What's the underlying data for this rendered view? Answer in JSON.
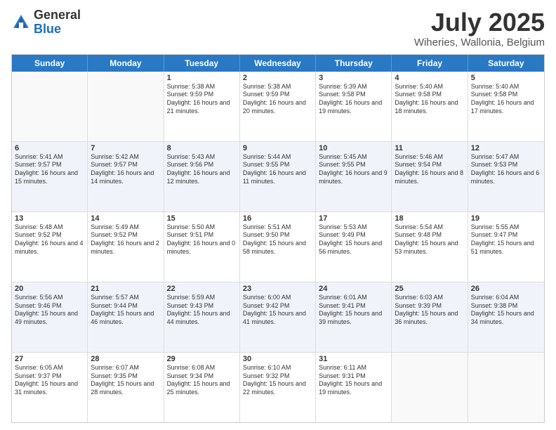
{
  "logo": {
    "general": "General",
    "blue": "Blue"
  },
  "title": "July 2025",
  "subtitle": "Wiheries, Wallonia, Belgium",
  "days": [
    "Sunday",
    "Monday",
    "Tuesday",
    "Wednesday",
    "Thursday",
    "Friday",
    "Saturday"
  ],
  "rows": [
    [
      {
        "day": "",
        "info": ""
      },
      {
        "day": "",
        "info": ""
      },
      {
        "day": "1",
        "info": "Sunrise: 5:38 AM\nSunset: 9:59 PM\nDaylight: 16 hours and 21 minutes."
      },
      {
        "day": "2",
        "info": "Sunrise: 5:38 AM\nSunset: 9:59 PM\nDaylight: 16 hours and 20 minutes."
      },
      {
        "day": "3",
        "info": "Sunrise: 5:39 AM\nSunset: 9:58 PM\nDaylight: 16 hours and 19 minutes."
      },
      {
        "day": "4",
        "info": "Sunrise: 5:40 AM\nSunset: 9:58 PM\nDaylight: 16 hours and 18 minutes."
      },
      {
        "day": "5",
        "info": "Sunrise: 5:40 AM\nSunset: 9:58 PM\nDaylight: 16 hours and 17 minutes."
      }
    ],
    [
      {
        "day": "6",
        "info": "Sunrise: 5:41 AM\nSunset: 9:57 PM\nDaylight: 16 hours and 15 minutes."
      },
      {
        "day": "7",
        "info": "Sunrise: 5:42 AM\nSunset: 9:57 PM\nDaylight: 16 hours and 14 minutes."
      },
      {
        "day": "8",
        "info": "Sunrise: 5:43 AM\nSunset: 9:56 PM\nDaylight: 16 hours and 12 minutes."
      },
      {
        "day": "9",
        "info": "Sunrise: 5:44 AM\nSunset: 9:55 PM\nDaylight: 16 hours and 11 minutes."
      },
      {
        "day": "10",
        "info": "Sunrise: 5:45 AM\nSunset: 9:55 PM\nDaylight: 16 hours and 9 minutes."
      },
      {
        "day": "11",
        "info": "Sunrise: 5:46 AM\nSunset: 9:54 PM\nDaylight: 16 hours and 8 minutes."
      },
      {
        "day": "12",
        "info": "Sunrise: 5:47 AM\nSunset: 9:53 PM\nDaylight: 16 hours and 6 minutes."
      }
    ],
    [
      {
        "day": "13",
        "info": "Sunrise: 5:48 AM\nSunset: 9:52 PM\nDaylight: 16 hours and 4 minutes."
      },
      {
        "day": "14",
        "info": "Sunrise: 5:49 AM\nSunset: 9:52 PM\nDaylight: 16 hours and 2 minutes."
      },
      {
        "day": "15",
        "info": "Sunrise: 5:50 AM\nSunset: 9:51 PM\nDaylight: 16 hours and 0 minutes."
      },
      {
        "day": "16",
        "info": "Sunrise: 5:51 AM\nSunset: 9:50 PM\nDaylight: 15 hours and 58 minutes."
      },
      {
        "day": "17",
        "info": "Sunrise: 5:53 AM\nSunset: 9:49 PM\nDaylight: 15 hours and 56 minutes."
      },
      {
        "day": "18",
        "info": "Sunrise: 5:54 AM\nSunset: 9:48 PM\nDaylight: 15 hours and 53 minutes."
      },
      {
        "day": "19",
        "info": "Sunrise: 5:55 AM\nSunset: 9:47 PM\nDaylight: 15 hours and 51 minutes."
      }
    ],
    [
      {
        "day": "20",
        "info": "Sunrise: 5:56 AM\nSunset: 9:46 PM\nDaylight: 15 hours and 49 minutes."
      },
      {
        "day": "21",
        "info": "Sunrise: 5:57 AM\nSunset: 9:44 PM\nDaylight: 15 hours and 46 minutes."
      },
      {
        "day": "22",
        "info": "Sunrise: 5:59 AM\nSunset: 9:43 PM\nDaylight: 15 hours and 44 minutes."
      },
      {
        "day": "23",
        "info": "Sunrise: 6:00 AM\nSunset: 9:42 PM\nDaylight: 15 hours and 41 minutes."
      },
      {
        "day": "24",
        "info": "Sunrise: 6:01 AM\nSunset: 9:41 PM\nDaylight: 15 hours and 39 minutes."
      },
      {
        "day": "25",
        "info": "Sunrise: 6:03 AM\nSunset: 9:39 PM\nDaylight: 15 hours and 36 minutes."
      },
      {
        "day": "26",
        "info": "Sunrise: 6:04 AM\nSunset: 9:38 PM\nDaylight: 15 hours and 34 minutes."
      }
    ],
    [
      {
        "day": "27",
        "info": "Sunrise: 6:05 AM\nSunset: 9:37 PM\nDaylight: 15 hours and 31 minutes."
      },
      {
        "day": "28",
        "info": "Sunrise: 6:07 AM\nSunset: 9:35 PM\nDaylight: 15 hours and 28 minutes."
      },
      {
        "day": "29",
        "info": "Sunrise: 6:08 AM\nSunset: 9:34 PM\nDaylight: 15 hours and 25 minutes."
      },
      {
        "day": "30",
        "info": "Sunrise: 6:10 AM\nSunset: 9:32 PM\nDaylight: 15 hours and 22 minutes."
      },
      {
        "day": "31",
        "info": "Sunrise: 6:11 AM\nSunset: 9:31 PM\nDaylight: 15 hours and 19 minutes."
      },
      {
        "day": "",
        "info": ""
      },
      {
        "day": "",
        "info": ""
      }
    ]
  ],
  "alt_rows": [
    1,
    3
  ]
}
